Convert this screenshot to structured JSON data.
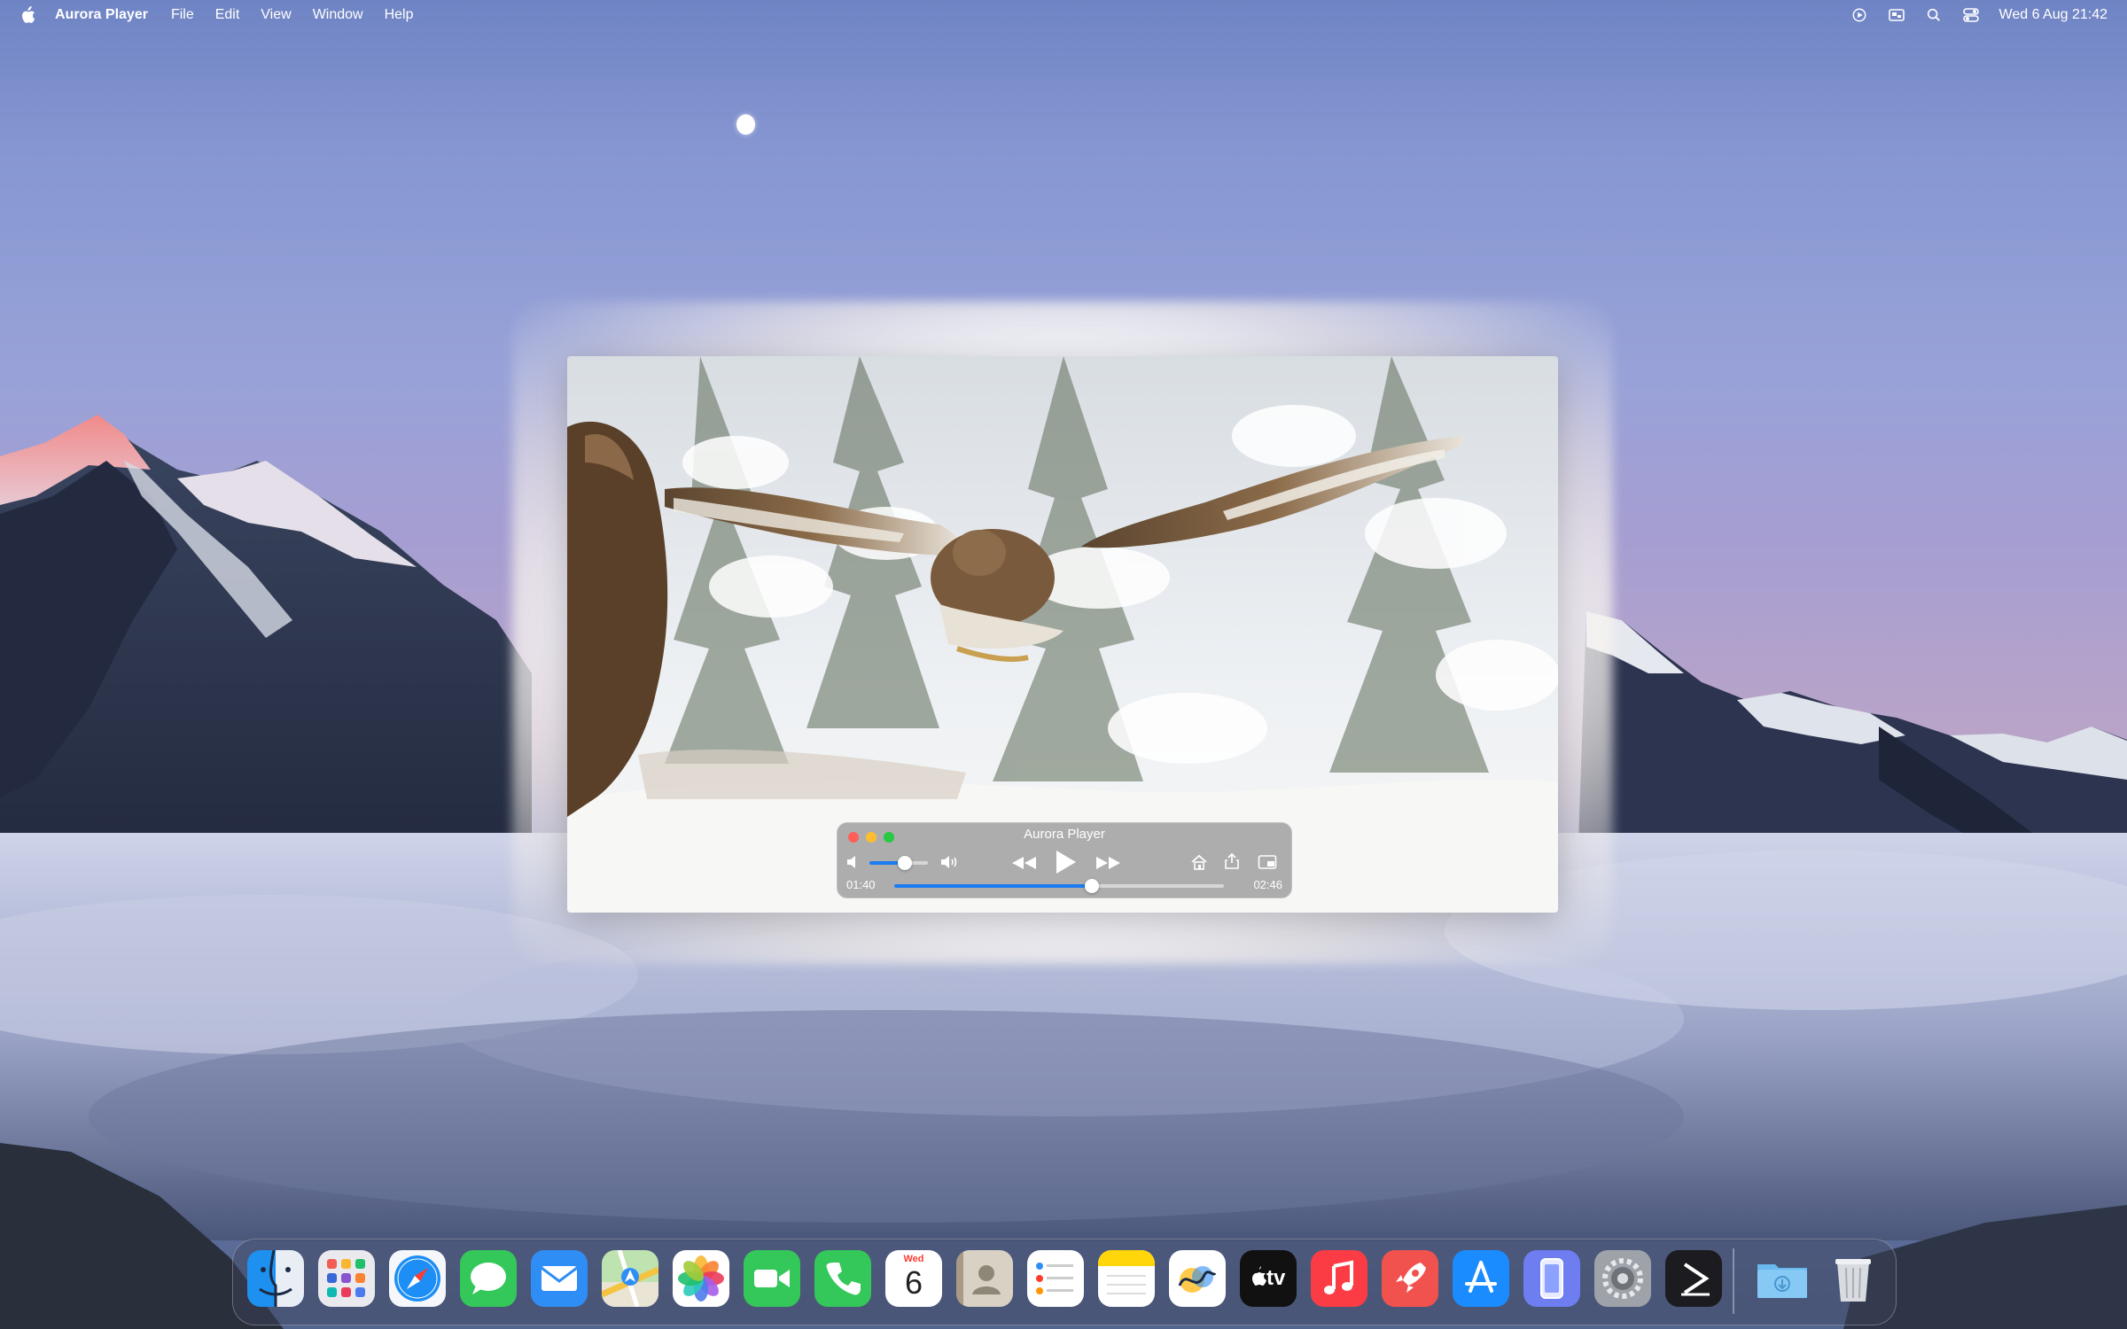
{
  "menubar": {
    "app_name": "Aurora Player",
    "menus": [
      "File",
      "Edit",
      "View",
      "Window",
      "Help"
    ],
    "clock": "Wed 6 Aug 21:42",
    "status_icons": [
      "play-circle-icon",
      "screen-mirror-icon",
      "search-icon",
      "control-center-icon"
    ]
  },
  "player": {
    "title": "Aurora Player",
    "elapsed": "01:40",
    "duration": "02:46",
    "progress_fraction": 0.6,
    "volume_fraction": 0.6,
    "accent_color": "#1a7cf0"
  },
  "dock": {
    "calendar_weekday": "Wed",
    "calendar_day": "6",
    "tv_label": "tv",
    "apps": [
      "Finder",
      "Launchpad",
      "Safari",
      "Messages",
      "Mail",
      "Maps",
      "Photos",
      "FaceTime",
      "Phone",
      "Calendar",
      "Contacts",
      "Reminders",
      "Notes",
      "Freeform",
      "TV",
      "Music",
      "Rocket",
      "App Store",
      "iPhone Mirroring",
      "System Settings",
      "Player",
      "Downloads",
      "Trash"
    ]
  }
}
